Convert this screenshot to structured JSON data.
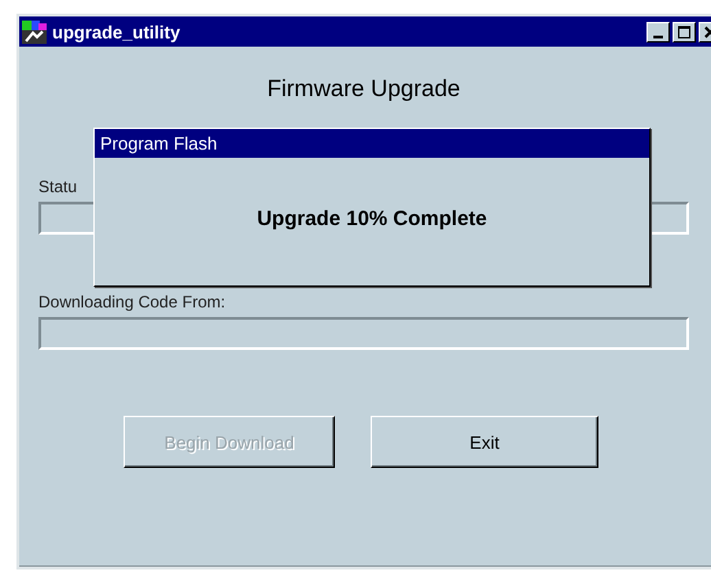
{
  "window": {
    "title": "upgrade_utility"
  },
  "heading": "Firmware Upgrade",
  "fields": [
    {
      "label": "Statu"
    },
    {
      "label": "Downloading Code From:"
    }
  ],
  "buttons": [
    {
      "label": "Begin Download",
      "disabled": true
    },
    {
      "label": "Exit",
      "disabled": false
    }
  ],
  "dialog": {
    "title": "Program Flash",
    "message": "Upgrade 10% Complete"
  }
}
